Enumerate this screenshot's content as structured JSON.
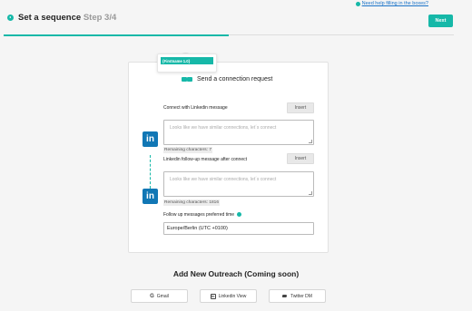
{
  "help": {
    "link_text": "Need help filling in the boxes?"
  },
  "header": {
    "title": "Set a sequence",
    "step": "Step 3/4",
    "next_label": "Next"
  },
  "progress": {
    "value_percent": 50
  },
  "card": {
    "title": "Send a connection request",
    "close_symbol": "×",
    "connect_section": {
      "label": "Connect with Linkedin message",
      "insert_label": "Insert",
      "placeholder": "Looks like we have similar connections, let´s connect",
      "remaining": "Remaining characters: 7",
      "dropdown_option": "{Firstname 1.0}"
    },
    "followup_section": {
      "label": "Linkedin follow-up message after connect",
      "insert_label": "Insert",
      "placeholder": "Looks like we have similar connections, let´s connect",
      "remaining": "Remaining characters: 1816"
    },
    "timezone": {
      "label": "Follow up messages preferred time",
      "value": "Europe/Berlin (UTC +0100)"
    },
    "linkedin_icon_text": "in"
  },
  "outreach": {
    "title": "Add New Outreach (Coming soon)",
    "buttons": [
      {
        "label": "Gmail",
        "icon": "G"
      },
      {
        "label": "Linkedin View",
        "icon": "in"
      },
      {
        "label": "Twitter DM",
        "icon": "twitter-bird-icon"
      }
    ]
  },
  "colors": {
    "accent": "#16b8a8",
    "linkedin": "#1177b5",
    "link": "#1a73c8"
  }
}
